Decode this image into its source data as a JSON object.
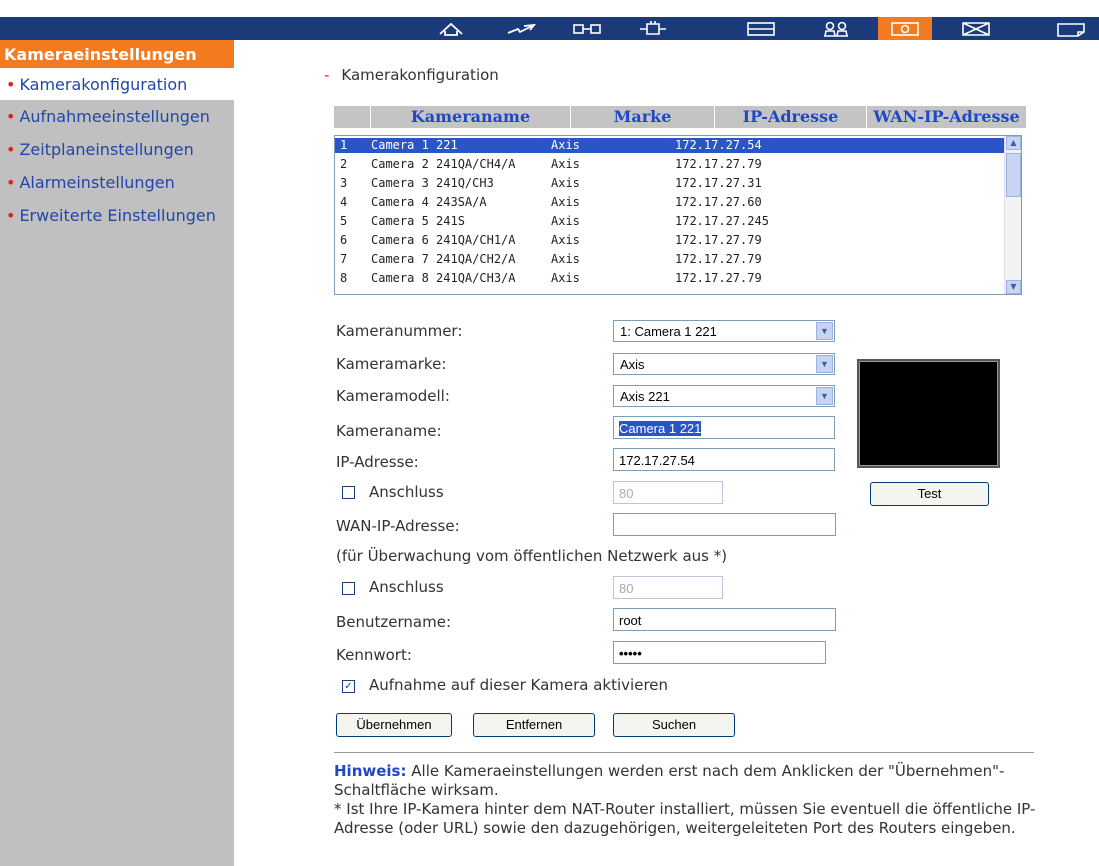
{
  "topbar": {
    "icons": [
      "home-icon",
      "network-icon",
      "device-icon",
      "plugin-icon",
      "display-icon",
      "users-icon",
      "camera-icon",
      "mail-icon",
      "folder-icon"
    ],
    "active_index": 6,
    "colors": {
      "bar": "#1b3a7a",
      "active": "#f47a20"
    }
  },
  "sidebar": {
    "heading": "Kameraeinstellungen",
    "items": [
      {
        "label": "Kamerakonfiguration"
      },
      {
        "label": "Aufnahmeeinstellungen"
      },
      {
        "label": "Zeitplaneinstellungen"
      },
      {
        "label": "Alarmeinstellungen"
      },
      {
        "label": "Erweiterte Einstellungen"
      }
    ]
  },
  "main": {
    "section_title": "Kamerakonfiguration",
    "table": {
      "headers": [
        "Kameraname",
        "Marke",
        "IP-Adresse",
        "WAN-IP-Adresse"
      ],
      "rows": [
        {
          "num": "1",
          "name": "Camera 1 221",
          "brand": "Axis",
          "ip": "172.17.27.54",
          "selected": true
        },
        {
          "num": "2",
          "name": "Camera 2 241QA/CH4/A",
          "brand": "Axis",
          "ip": "172.17.27.79"
        },
        {
          "num": "3",
          "name": "Camera 3 241Q/CH3",
          "brand": "Axis",
          "ip": "172.17.27.31"
        },
        {
          "num": "4",
          "name": "Camera 4 243SA/A",
          "brand": "Axis",
          "ip": "172.17.27.60"
        },
        {
          "num": "5",
          "name": "Camera 5 241S",
          "brand": "Axis",
          "ip": "172.17.27.245"
        },
        {
          "num": "6",
          "name": "Camera 6 241QA/CH1/A",
          "brand": "Axis",
          "ip": "172.17.27.79"
        },
        {
          "num": "7",
          "name": "Camera 7 241QA/CH2/A",
          "brand": "Axis",
          "ip": "172.17.27.79"
        },
        {
          "num": "8",
          "name": "Camera 8 241QA/CH3/A",
          "brand": "Axis",
          "ip": "172.17.27.79"
        }
      ]
    },
    "form": {
      "camera_number_label": "Kameranummer:",
      "camera_number_value": "1: Camera 1 221",
      "brand_label": "Kameramarke:",
      "brand_value": "Axis",
      "model_label": "Kameramodell:",
      "model_value": "Axis 221",
      "name_label": "Kameraname:",
      "name_value": "Camera 1 221",
      "ip_label": "IP-Adresse:",
      "ip_value": "172.17.27.54",
      "port_label": "Anschluss",
      "port_value": "80",
      "port_checked": false,
      "wan_ip_label": "WAN-IP-Adresse:",
      "wan_ip_value": "",
      "wan_hint": "(für Überwachung vom öffentlichen Netzwerk aus *)",
      "wan_port_label": "Anschluss",
      "wan_port_value": "80",
      "wan_port_checked": false,
      "user_label": "Benutzername:",
      "user_value": "root",
      "password_label": "Kennwort:",
      "password_value": "•••••",
      "enable_label": "Aufnahme auf dieser Kamera aktivieren",
      "enable_checked": true,
      "test_button": "Test"
    },
    "buttons": {
      "apply": "Übernehmen",
      "remove": "Entfernen",
      "search": "Suchen"
    },
    "note": {
      "label": "Hinweis:",
      "text1": "Alle Kameraeinstellungen werden erst nach dem Anklicken der \"Übernehmen\"-Schaltfläche wirksam.",
      "text2": "* Ist Ihre IP-Kamera hinter dem NAT-Router installiert, müssen Sie eventuell die öffentliche IP-Adresse (oder URL) sowie den dazugehörigen, weitergeleiteten Port des Routers eingeben."
    }
  }
}
